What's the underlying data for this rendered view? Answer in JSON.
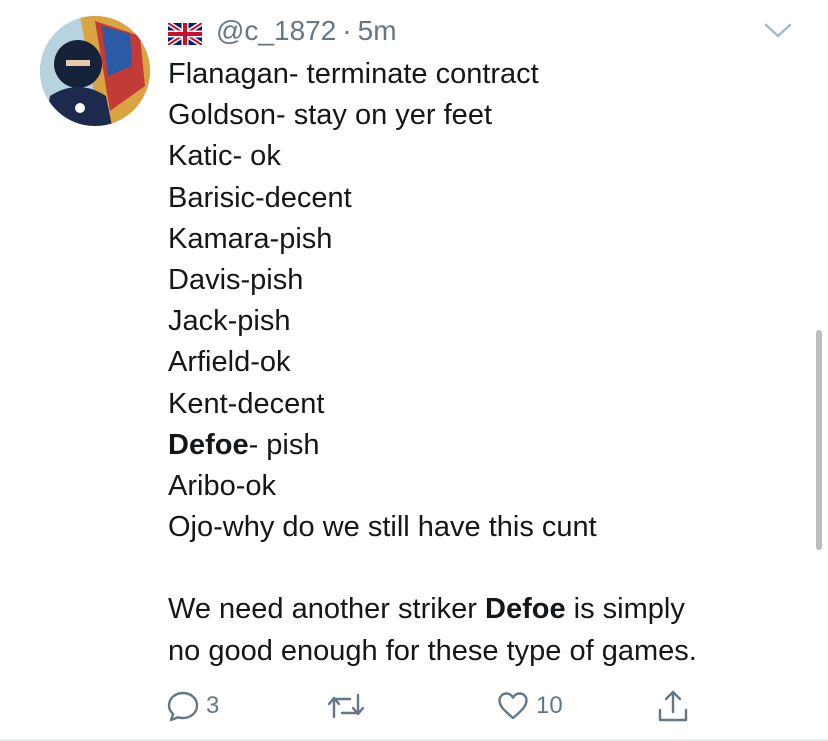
{
  "tweet": {
    "handle": "@c_1872",
    "separator": "·",
    "time": "5m",
    "flag_icon": "uk-flag-icon",
    "lines": [
      {
        "a": "Flanagan- terminate contract"
      },
      {
        "a": "Goldson- stay on yer feet"
      },
      {
        "a": "Katic- ok"
      },
      {
        "a": "Barisic-decent"
      },
      {
        "a": "Kamara-pish"
      },
      {
        "a": "Davis-pish"
      },
      {
        "a": "Jack-pish"
      },
      {
        "a": "Arfield-ok"
      },
      {
        "a": "Kent-decent"
      },
      {
        "b": "Defoe",
        "a": "- pish"
      },
      {
        "a": "Aribo-ok"
      },
      {
        "a": "Ojo-why do we still have this cunt"
      },
      {
        "a": "We need another striker ",
        "b": "Defoe",
        "c": " is simply"
      },
      {
        "a": "no good enough for these type of games."
      }
    ]
  },
  "actions": {
    "reply_count": "3",
    "like_count": "10"
  },
  "colors": {
    "text": "#14171a",
    "muted": "#657786",
    "scrollbar": "#bdbdbd"
  }
}
